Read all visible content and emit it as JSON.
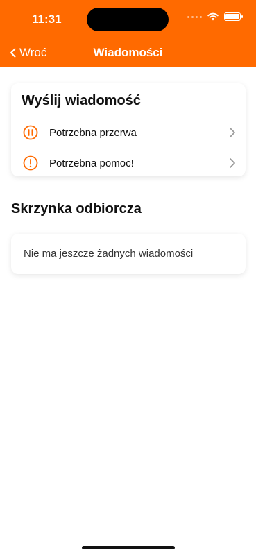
{
  "status_bar": {
    "time": "11:31"
  },
  "nav": {
    "back_label": "Wroć",
    "title": "Wiadomości"
  },
  "send_card": {
    "title": "Wyślij wiadomość",
    "items": [
      {
        "label": "Potrzebna przerwa",
        "icon": "pause-circle-icon"
      },
      {
        "label": "Potrzebna pomoc!",
        "icon": "exclamation-circle-icon"
      }
    ]
  },
  "inbox": {
    "title": "Skrzynka odbiorcza",
    "empty_text": "Nie ma jeszcze żadnych wiadomości"
  },
  "colors": {
    "accent": "#ff6a00"
  }
}
